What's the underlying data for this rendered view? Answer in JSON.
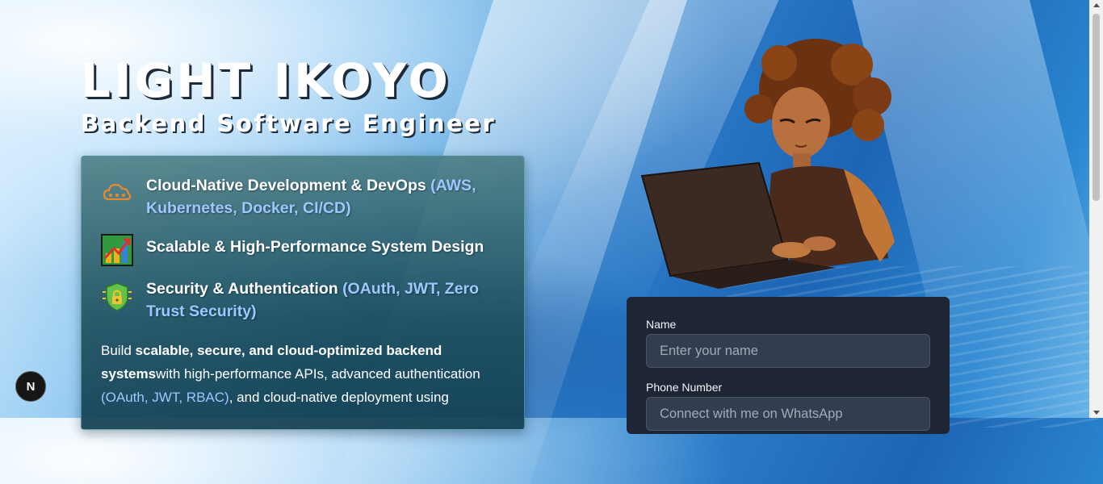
{
  "hero": {
    "title": "LIGHT IKOYO",
    "subtitle": "Backend Software Engineer"
  },
  "skills": [
    {
      "icon": "cloud-icon",
      "title": "Cloud-Native Development & DevOps",
      "tech": "(AWS, Kubernetes, Docker, CI/CD)"
    },
    {
      "icon": "growth-chart-icon",
      "title": "Scalable & High-Performance System Design",
      "tech": ""
    },
    {
      "icon": "security-shield-icon",
      "title": "Security & Authentication",
      "tech": "(OAuth, JWT, Zero Trust Security)"
    }
  ],
  "bio": {
    "prefix": "Build ",
    "bold": "scalable, secure, and cloud-optimized backend systems",
    "middle": "with high-performance APIs, advanced authentication ",
    "tech": "(OAuth, JWT, RBAC)",
    "suffix": ", and cloud-native deployment using"
  },
  "contact": {
    "name_label": "Name",
    "name_placeholder": "Enter your name",
    "phone_label": "Phone Number",
    "phone_placeholder": "Connect with me on WhatsApp"
  },
  "nav_badge": "N",
  "colors": {
    "accent_tech": "#9fc7ff",
    "card_dark": "#1e2636",
    "input_bg": "#333d4f"
  }
}
